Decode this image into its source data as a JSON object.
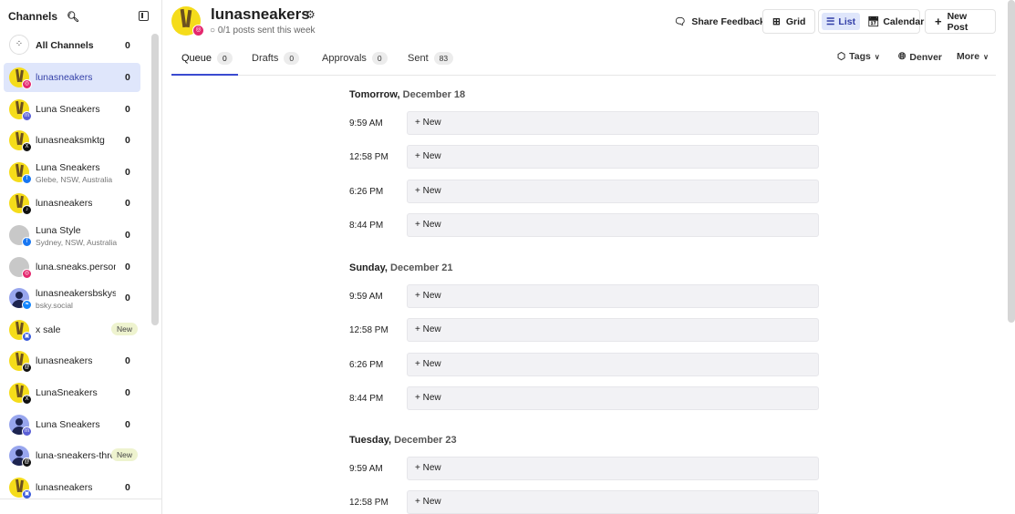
{
  "sidebar": {
    "title": "Channels",
    "all_channels": {
      "label": "All Channels",
      "count": "0"
    },
    "channels": [
      {
        "name": "lunasneakers",
        "count": "0",
        "platform": "instagram",
        "avatar": "yellow",
        "active": true
      },
      {
        "name": "Luna Sneakers",
        "count": "0",
        "platform": "mastodon",
        "avatar": "yellow"
      },
      {
        "name": "lunasneaksmktg",
        "count": "0",
        "platform": "x",
        "avatar": "yellow"
      },
      {
        "name": "Luna Sneakers",
        "sub": "Glebe, NSW, Australia",
        "count": "0",
        "platform": "facebook",
        "avatar": "yellow"
      },
      {
        "name": "lunasneakers",
        "count": "0",
        "platform": "tiktok",
        "avatar": "yellow"
      },
      {
        "name": "Luna Style",
        "sub": "Sydney, NSW, Australia",
        "count": "0",
        "platform": "facebook",
        "avatar": "gray"
      },
      {
        "name": "luna.sneaks.persona",
        "count": "0",
        "platform": "instagram",
        "avatar": "gray"
      },
      {
        "name": "lunasneakersbskyso",
        "sub": "bsky.social",
        "count": "0",
        "platform": "bluesky",
        "avatar": "person"
      },
      {
        "name": "x sale",
        "new": "New",
        "platform": "google",
        "avatar": "yellow"
      },
      {
        "name": "lunasneakers",
        "count": "0",
        "platform": "threads",
        "avatar": "yellow"
      },
      {
        "name": "LunaSneakers",
        "count": "0",
        "platform": "x",
        "avatar": "yellow"
      },
      {
        "name": "Luna Sneakers",
        "count": "0",
        "platform": "mastodon",
        "avatar": "person"
      },
      {
        "name": "luna-sneakers-thre",
        "new": "New",
        "platform": "threads",
        "avatar": "person"
      },
      {
        "name": "lunasneakers",
        "count": "0",
        "platform": "google",
        "avatar": "yellow"
      }
    ]
  },
  "header": {
    "title": "lunasneakers",
    "subtitle": "0/1 posts sent this week",
    "share_feedback": "Share Feedback",
    "grid": "Grid",
    "list": "List",
    "calendar": "Calendar",
    "new_post": "New Post"
  },
  "tabs": [
    {
      "label": "Queue",
      "count": "0"
    },
    {
      "label": "Drafts",
      "count": "0"
    },
    {
      "label": "Approvals",
      "count": "0"
    },
    {
      "label": "Sent",
      "count": "83"
    }
  ],
  "toolbar": {
    "tags": "Tags",
    "timezone": "Denver",
    "more": "More"
  },
  "days": [
    {
      "prefix": "Tomorrow,",
      "date": "December 18",
      "slots": [
        "9:59 AM",
        "12:58 PM",
        "6:26 PM",
        "8:44 PM"
      ]
    },
    {
      "prefix": "Sunday,",
      "date": "December 21",
      "slots": [
        "9:59 AM",
        "12:58 PM",
        "6:26 PM",
        "8:44 PM"
      ]
    },
    {
      "prefix": "Tuesday,",
      "date": "December 23",
      "slots": [
        "9:59 AM",
        "12:58 PM"
      ]
    }
  ],
  "slot_label": "New",
  "colors": {
    "instagram": "#e4286e",
    "mastodon": "#5a5fd6",
    "x": "#111111",
    "facebook": "#1877f2",
    "tiktok": "#111111",
    "bluesky": "#1185fe",
    "google": "#3b5bdb",
    "threads": "#111111",
    "accent": "#3a4ad0"
  }
}
